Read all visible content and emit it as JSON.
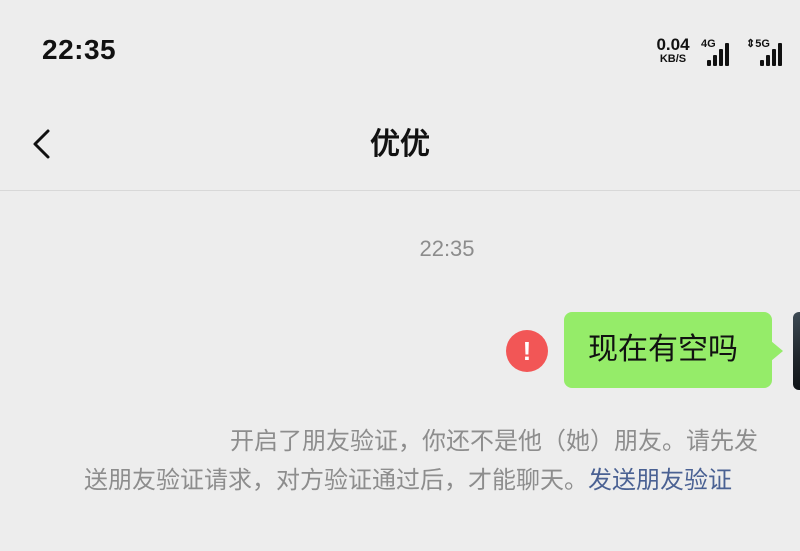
{
  "status_bar": {
    "time": "22:35",
    "net_speed_value": "0.04",
    "net_speed_unit": "KB/S",
    "signal_1_label": "4G",
    "signal_2_label": "5G",
    "signal_1_icon": "signal-4g-icon",
    "signal_2_icon": "signal-5g-icon"
  },
  "nav": {
    "back_icon": "chevron-left-icon",
    "title": "优优"
  },
  "chat": {
    "timestamp": "22:35",
    "message": {
      "text": "现在有空吗",
      "status_icon": "error-exclamation-icon",
      "status_mark": "!",
      "bubble_color": "#95ec69",
      "error_color": "#f25656"
    },
    "notice": {
      "line1": "开启了朋友验证，你还不是他（她）朋友。请先发",
      "line2": "送朋友验证请求，对方验证通过后，才能聊天。",
      "link": "发送朋友验证",
      "link_color": "#4a6193"
    }
  }
}
